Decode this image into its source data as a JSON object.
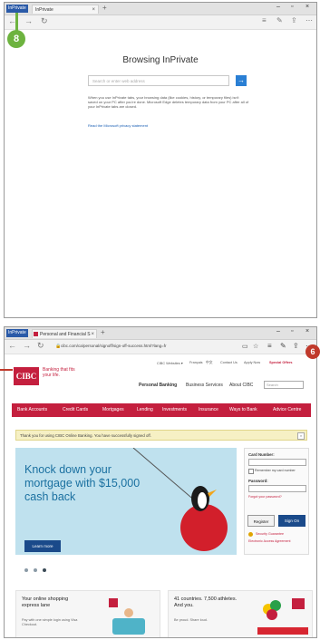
{
  "top_window": {
    "private_badge": "InPrivate",
    "tab_label": "InPrivate",
    "new_tab": "+",
    "win_min": "–",
    "win_max": "▫",
    "win_close": "×",
    "callout_number": "8",
    "title": "Browsing InPrivate",
    "search_placeholder": "Search or enter web address",
    "go_arrow": "→",
    "description": "When you use InPrivate tabs, your browsing data (like cookies, history, or temporary files) isn't saved on your PC after you're done. Microsoft Edge deletes temporary data from your PC after all of your InPrivate tabs are closed.",
    "privacy_link": "Read the Microsoft privacy statement",
    "icons": [
      "back-icon",
      "forward-icon",
      "refresh-icon",
      "reading-list-icon",
      "note-icon",
      "share-icon",
      "more-icon"
    ]
  },
  "bottom_window": {
    "private_badge": "InPrivate",
    "tab_label": "Personal and Financial S",
    "tab_close": "×",
    "new_tab": "+",
    "win_min": "–",
    "win_max": "▫",
    "win_close": "×",
    "callout_number": "6",
    "url": "cibc.com/ca/personal/signoff/sign-off-success.html?lang=fr",
    "cibc": {
      "logo": "CIBC",
      "tagline": "Banking that fits your life.",
      "top_links": [
        "CIBC Websites ▾",
        "Français",
        "中文",
        "Contact Us",
        "Apply Now",
        "Special Offers"
      ],
      "sub_links": [
        "Personal Banking",
        "Business Services",
        "About CIBC"
      ],
      "search_placeholder": "Search",
      "menu": [
        "Bank Accounts",
        "Credit Cards",
        "Mortgages",
        "Lending",
        "Investments",
        "Insurance",
        "Ways to Bank",
        "Advice Centre"
      ],
      "notice": "Thank you for using CIBC Online Banking. You have successfully signed off.",
      "notice_close": "×",
      "hero_text": "Knock down your mortgage with $15,000 cash back",
      "hero_button": "Learn more",
      "login": {
        "card_label": "Card Number:",
        "remember": "Remember my card number",
        "password_label": "Password:",
        "forgot": "Forgot your password?",
        "register": "Register",
        "sign_on": "Sign On",
        "guaranteed": "Security Guarantee",
        "agreement": "Electronic Access Agreement"
      },
      "promo1": {
        "title": "Your online shopping express lane",
        "sub": "Pay with one simple login using Visa Checkout."
      },
      "promo2": {
        "title": "41 countries. 7,500 athletes. And you.",
        "sub": "Be proud. Share loud."
      }
    }
  },
  "colors": {
    "callout_green": "#6db33f",
    "callout_red": "#c0392b",
    "cibc_red": "#c41f3e",
    "edge_blue": "#2a7fd4"
  }
}
